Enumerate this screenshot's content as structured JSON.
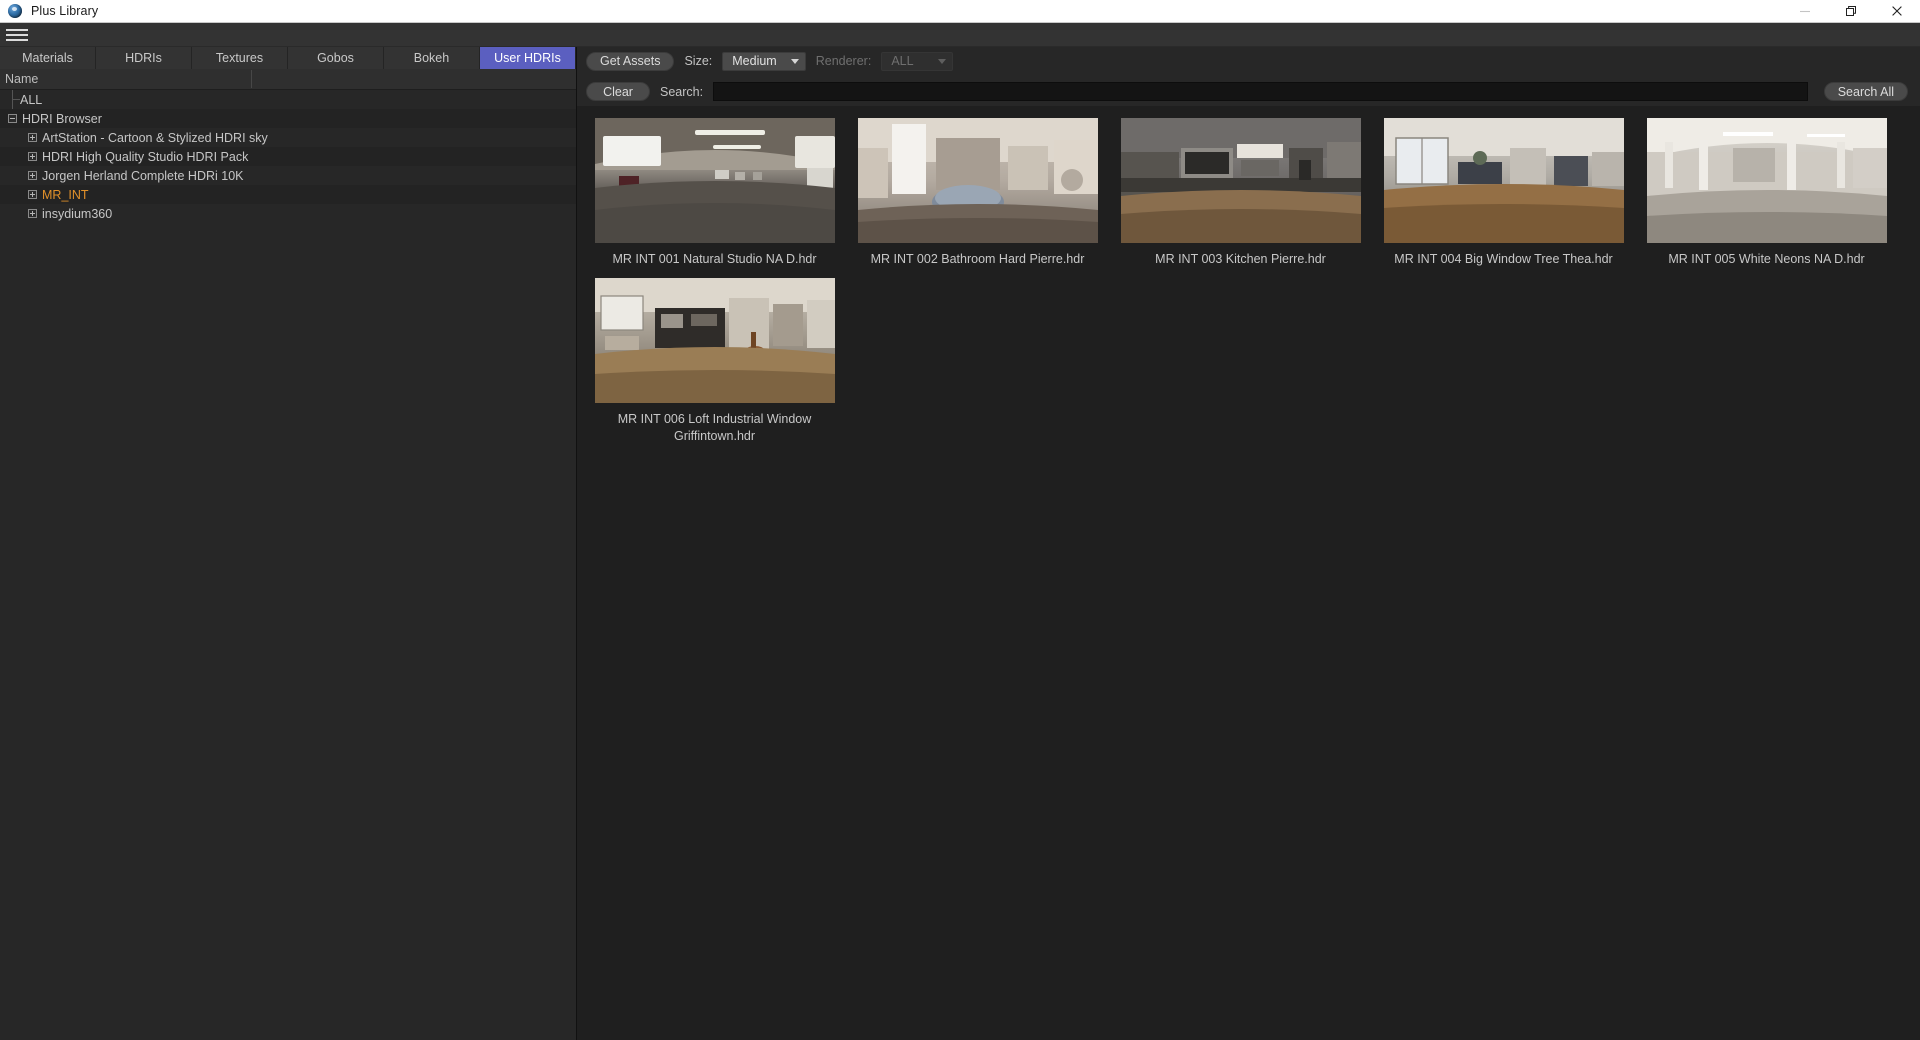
{
  "window": {
    "title": "Plus Library",
    "app_icon": "sphere-icon",
    "controls": {
      "minimize": "minimize-icon",
      "maximize": "restore-icon",
      "close": "close-icon"
    }
  },
  "menu": {
    "hamburger": "hamburger-menu-icon"
  },
  "tabs": [
    {
      "label": "Materials",
      "active": false
    },
    {
      "label": "HDRIs",
      "active": false
    },
    {
      "label": "Textures",
      "active": false
    },
    {
      "label": "Gobos",
      "active": false
    },
    {
      "label": "Bokeh",
      "active": false
    },
    {
      "label": "User HDRIs",
      "active": true
    }
  ],
  "tree": {
    "column_header": "Name",
    "items": [
      {
        "label": "ALL",
        "indent": 1,
        "toggle": "none",
        "highlighted": false
      },
      {
        "label": "HDRI Browser",
        "indent": 0,
        "toggle": "minus",
        "highlighted": false
      },
      {
        "label": "ArtStation - Cartoon & Stylized HDRI sky",
        "indent": 2,
        "toggle": "plus",
        "highlighted": false
      },
      {
        "label": "HDRI High Quality Studio HDRI Pack",
        "indent": 2,
        "toggle": "plus",
        "highlighted": false
      },
      {
        "label": "Jorgen Herland Complete HDRi 10K",
        "indent": 2,
        "toggle": "plus",
        "highlighted": false
      },
      {
        "label": "MR_INT",
        "indent": 2,
        "toggle": "plus",
        "highlighted": true
      },
      {
        "label": "insydium360",
        "indent": 2,
        "toggle": "plus",
        "highlighted": false
      }
    ]
  },
  "toolbar": {
    "get_assets_label": "Get Assets",
    "size_label": "Size:",
    "size_value": "Medium",
    "renderer_label": "Renderer:",
    "renderer_value": "ALL",
    "clear_label": "Clear",
    "search_label": "Search:",
    "search_value": "",
    "search_placeholder": "",
    "search_all_label": "Search All"
  },
  "assets": [
    {
      "name": "MR INT 001 Natural Studio NA D.hdr",
      "selected": false,
      "art": "studio"
    },
    {
      "name": "MR INT 002 Bathroom Hard Pierre.hdr",
      "selected": false,
      "art": "bathroom"
    },
    {
      "name": "MR INT 003 Kitchen Pierre.hdr",
      "selected": true,
      "art": "kitchen"
    },
    {
      "name": "MR INT 004 Big Window Tree Thea.hdr",
      "selected": true,
      "art": "bigwindow"
    },
    {
      "name": "MR INT 005 White Neons NA D.hdr",
      "selected": true,
      "art": "whiteneons"
    },
    {
      "name": "MR INT 006 Loft Industrial Window Griffintown.hdr",
      "selected": true,
      "art": "loft"
    }
  ],
  "colors": {
    "accent_tab": "#5b5fc0",
    "tree_highlight": "#e0902a",
    "selection_border": "#a8833f",
    "panel_bg": "#272727",
    "grid_bg": "#1f1f1f"
  }
}
